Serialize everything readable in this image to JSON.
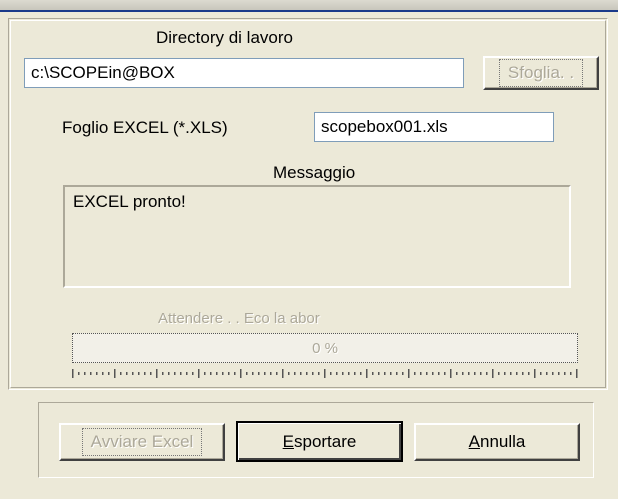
{
  "dialog": {
    "working_dir_label": "Directory di lavoro",
    "working_dir_value": "c:\\SCOPEin@BOX",
    "browse_label": "Sfoglia. .",
    "excel_sheet_label": "Foglio EXCEL (*.XLS)",
    "excel_sheet_value": "scopebox001.xls",
    "message_label": "Messaggio",
    "message_text": "EXCEL pronto!",
    "wait_label": "Attendere . .   Eco la abor",
    "progress_text": "0 %",
    "progress_value": 0
  },
  "buttons": {
    "start_excel": "Avviare Excel",
    "export_prefix": "E",
    "export_rest": "sportare",
    "cancel_prefix": "A",
    "cancel_rest": "nnulla"
  },
  "colors": {
    "face": "#ece9d8",
    "disabled_text": "#aca899",
    "edit_border": "#7f9db9"
  }
}
